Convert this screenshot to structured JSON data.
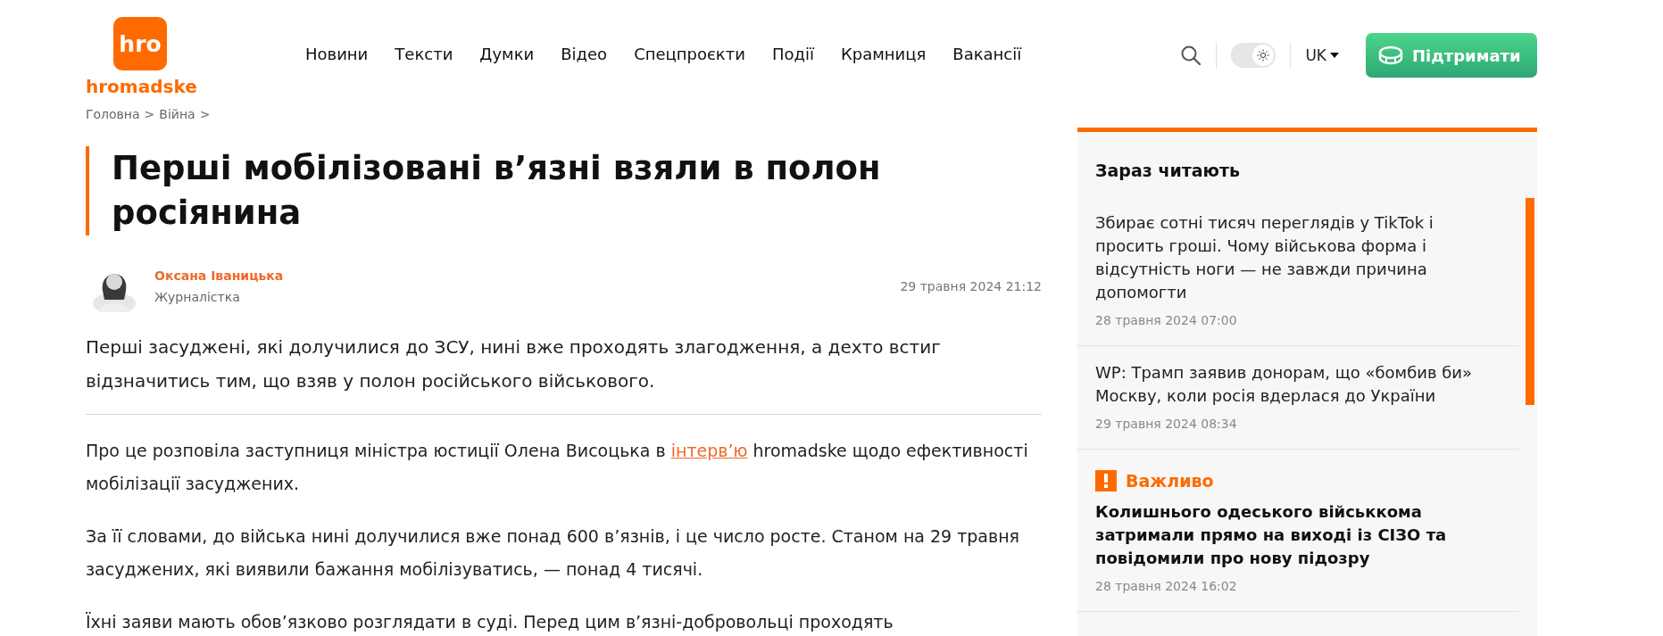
{
  "header": {
    "logo_mark": "hro",
    "logo_text": "hromadske",
    "nav": [
      {
        "label": "Новини",
        "selected": false
      },
      {
        "label": "Тексти",
        "selected": false
      },
      {
        "label": "Думки",
        "selected": false
      },
      {
        "label": "Відео",
        "selected": false
      },
      {
        "label": "Спецпроєкти",
        "selected": false
      },
      {
        "label": "Події",
        "selected": false
      },
      {
        "label": "Крамниця",
        "selected": false
      },
      {
        "label": "Вакансії",
        "selected": false
      }
    ],
    "theme_toggle": {
      "on": true
    },
    "language": "UK",
    "support_button": "Підтримати"
  },
  "breadcrumbs": [
    {
      "label": "Головна",
      "separator": ">"
    },
    {
      "label": "Війна",
      "separator": ">"
    }
  ],
  "article": {
    "title": "Перші мобілізовані в’язні взяли в полон росіянина",
    "author": {
      "name": "Оксана Іваницька",
      "role": "Журналістка"
    },
    "date": "29 травня 2024 21:12",
    "lede": "Перші засуджені, які долучилися до ЗСУ, нині вже проходять злагодження, а дехто встиг відзначитись тим, що взяв у полон російського військового.",
    "paragraphs": [
      {
        "before": "Про це розповіла заступниця міністра юстиції Олена Висоцька в ",
        "link": "інтерв’ю",
        "after": " hromadske щодо ефективності мобілізації засуджених."
      },
      {
        "before": "За її словами, до війська нині долучилися вже понад 600 в’язнів, і це число росте. Станом на 29 травня засуджених, які виявили бажання мобілізуватись, — понад 4 тисячі."
      },
      {
        "before": "Їхні заяви мають обов’язково розглядати в суді. Перед цим в’язні-добровольці проходять"
      }
    ]
  },
  "sidebar": {
    "title": "Зараз читають",
    "items": [
      {
        "kind": "regular",
        "title": "Збирає сотні тисяч переглядів у TikTok і просить гроші. Чому військова форма і відсутність ноги — не завжди причина допомогти",
        "date": "28 травня 2024 07:00"
      },
      {
        "kind": "regular",
        "title": "WP: Трамп заявив донорам, що «бомбив би» Москву, коли росія вдерлася до України",
        "date": "29 травня 2024 08:34"
      },
      {
        "kind": "important",
        "label": "Важливо",
        "title": "Колишнього одеського військкома затримали прямо на виході із СІЗО та повідомили про нову підозру",
        "date": "28 травня 2024 16:02"
      }
    ]
  }
}
